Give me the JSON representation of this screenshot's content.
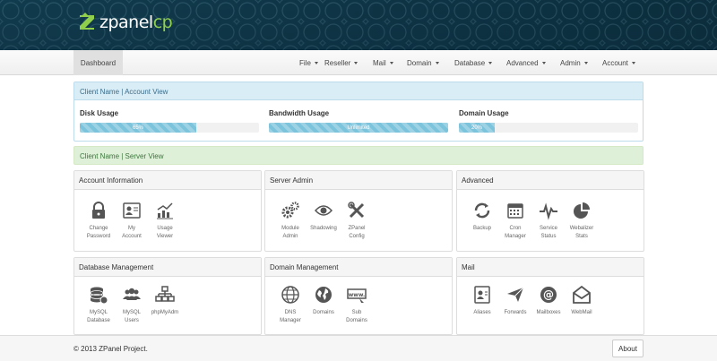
{
  "brand": {
    "name_main": "zpanel",
    "name_accent": "cp",
    "logo_letter": "Z"
  },
  "nav": {
    "dashboard": "Dashboard",
    "menus": [
      "File",
      "Reseller",
      "Mail",
      "Domain",
      "Database",
      "Advanced",
      "Admin",
      "Account"
    ]
  },
  "account_view": {
    "header": "Client Name | Account View",
    "disk": {
      "label": "Disk Usage",
      "value": "65%",
      "percent": 65
    },
    "bandwidth": {
      "label": "Bandwidth Usage",
      "value": "Unlimited",
      "percent": 100
    },
    "domain": {
      "label": "Domain Usage",
      "value": "20%",
      "percent": 20
    }
  },
  "server_view": {
    "header": "Client Name | Server View"
  },
  "boxes": {
    "account_information": {
      "title": "Account Information",
      "modules": [
        "Change\nPassword",
        "My\nAccount",
        "Usage\nViewer"
      ]
    },
    "server_admin": {
      "title": "Server Admin",
      "modules": [
        "Module\nAdmin",
        "Shadowing",
        "ZPanel\nConfig"
      ]
    },
    "advanced": {
      "title": "Advanced",
      "modules": [
        "Backup",
        "Cron\nManager",
        "Service\nStatus",
        "Webalizer\nStats"
      ]
    },
    "database_management": {
      "title": "Database Management",
      "modules": [
        "MySQL\nDatabase",
        "MySQL\nUsers",
        "phpMyAdm"
      ]
    },
    "domain_management": {
      "title": "Domain Management",
      "modules": [
        "DNS\nManager",
        "Domains",
        "Sub\nDomains"
      ]
    },
    "mail": {
      "title": "Mail",
      "modules": [
        "Aliases",
        "Forwards",
        "Mailboxes",
        "WebMail"
      ]
    }
  },
  "footer": {
    "copyright": "© 2013 ZPanel Project.",
    "about": "About"
  },
  "colors": {
    "info_bg": "#d9edf7",
    "success_bg": "#dff0d8",
    "progress": "#7cc3dc",
    "brand_accent": "#8fcf4c"
  }
}
